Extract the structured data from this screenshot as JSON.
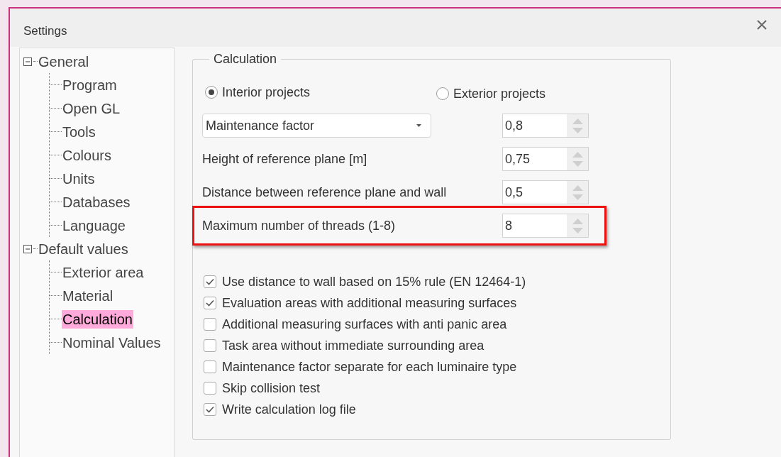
{
  "window": {
    "title": "Settings"
  },
  "tree": [
    {
      "label": "General",
      "expanded": true,
      "selected": false,
      "children": [
        {
          "label": "Program",
          "selected": false
        },
        {
          "label": "Open GL",
          "selected": false
        },
        {
          "label": "Tools",
          "selected": false
        },
        {
          "label": "Colours",
          "selected": false
        },
        {
          "label": "Units",
          "selected": false
        },
        {
          "label": "Databases",
          "selected": false
        },
        {
          "label": "Language",
          "selected": false
        }
      ]
    },
    {
      "label": "Default values",
      "expanded": true,
      "selected": false,
      "children": [
        {
          "label": "Exterior area",
          "selected": false
        },
        {
          "label": "Material",
          "selected": false
        },
        {
          "label": "Calculation",
          "selected": true
        },
        {
          "label": "Nominal Values",
          "selected": false
        }
      ]
    }
  ],
  "group": {
    "title": "Calculation",
    "project_type": [
      {
        "label": "Interior projects",
        "selected": true
      },
      {
        "label": "Exterior projects",
        "selected": false
      }
    ],
    "fields": [
      {
        "kind": "dropdown",
        "label": "Maintenance factor",
        "value": "0,8",
        "highlighted": false
      },
      {
        "kind": "text",
        "label": "Height of reference plane [m]",
        "value": "0,75",
        "highlighted": false
      },
      {
        "kind": "text",
        "label": "Distance between reference plane and wall",
        "value": "0,5",
        "highlighted": false
      },
      {
        "kind": "text",
        "label": "Maximum number of threads (1-8)",
        "value": "8",
        "highlighted": true
      }
    ],
    "options": [
      {
        "label": "Use distance to wall based on 15% rule (EN 12464-1)",
        "checked": true
      },
      {
        "label": "Evaluation areas with additional measuring surfaces",
        "checked": true
      },
      {
        "label": "Additional measuring surfaces with anti panic area",
        "checked": false
      },
      {
        "label": "Task area without immediate surrounding area",
        "checked": false
      },
      {
        "label": "Maintenance factor separate for each luminaire type",
        "checked": false
      },
      {
        "label": "Skip collision test",
        "checked": false
      },
      {
        "label": "Write calculation log file",
        "checked": true
      }
    ]
  }
}
